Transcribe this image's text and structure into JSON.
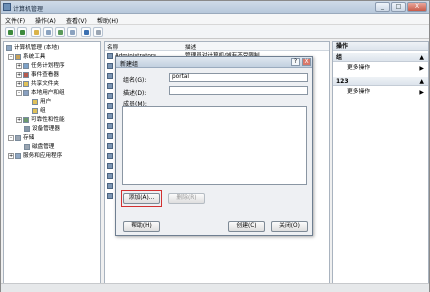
{
  "window": {
    "title": "计算机管理",
    "controls": [
      "_",
      "□",
      "X"
    ]
  },
  "menu": [
    "文件(F)",
    "操作(A)",
    "查看(V)",
    "帮助(H)"
  ],
  "tree": {
    "root": "计算机管理 (本地)",
    "system_tools": "系统工具",
    "task_scheduler": "任务计划程序",
    "event_viewer": "事件查看器",
    "shared_folders": "共享文件夹",
    "local_users": "本地用户和组",
    "users": "用户",
    "groups": "组",
    "performance": "可靠性和性能",
    "device_manager": "设备管理器",
    "storage": "存储",
    "disk_management": "磁盘管理",
    "services": "服务和应用程序"
  },
  "list": {
    "col_name": "名称",
    "col_desc": "描述",
    "rows": [
      {
        "name": "Administrators",
        "desc": "管理员对计算机/域有不受限制"
      }
    ]
  },
  "actions": {
    "header": "操作",
    "section1": "组",
    "more1": "更多操作",
    "section2": "123",
    "more2": "更多操作"
  },
  "dialog": {
    "title": "新建组",
    "help_btn": "?",
    "close_btn": "X",
    "group_name_label": "组名(G):",
    "group_name_value": "portal",
    "desc_label": "描述(D):",
    "members_label": "成员(M):",
    "add_btn": "添加(A)...",
    "remove_btn": "删除(R)",
    "help_button": "帮助(H)",
    "create_button": "创建(C)",
    "close_button": "关闭(O)"
  }
}
